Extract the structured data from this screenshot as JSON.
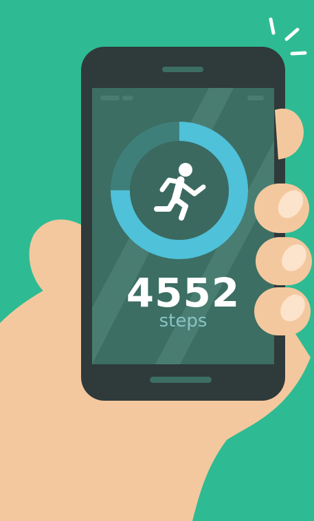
{
  "colors": {
    "background": "#2ebb93",
    "skin": "#f4c89e",
    "skin_shadow": "#e3aa7a",
    "nail": "#fce3cc",
    "phone_body": "#2f3a3a",
    "screen": "#3c6e63",
    "screen_glare": "#4a7d72",
    "ring_background": "#3f7f79",
    "ring_progress": "#4fc1d9",
    "inner_circle": "#3b6960",
    "step_count_text": "#ffffff",
    "step_unit_text": "#88c3c7",
    "sparkle": "#ffffff"
  },
  "activity": {
    "icon": "running-person-icon",
    "progress": 0.75,
    "step_count": "4552",
    "step_unit": "steps"
  }
}
